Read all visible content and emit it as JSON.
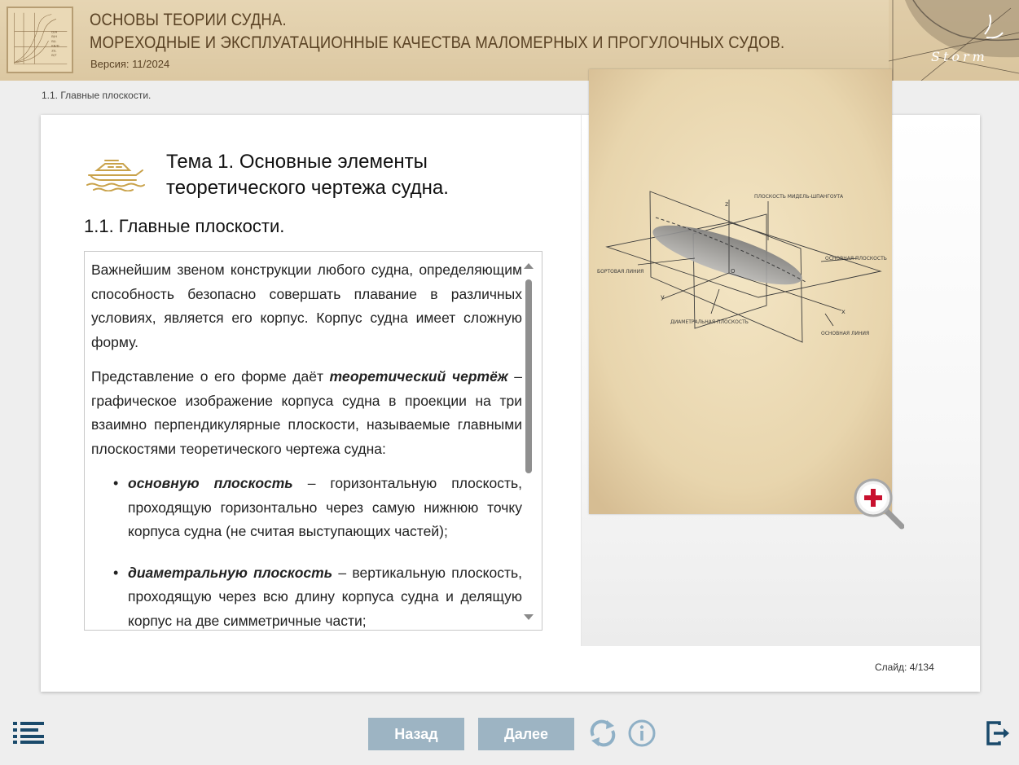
{
  "header": {
    "title_line1": "ОСНОВЫ ТЕОРИИ СУДНА.",
    "title_line2": "МОРЕХОДНЫЕ И ЭКСПЛУАТАЦИОННЫЕ КАЧЕСТВА МАЛОМЕРНЫХ И ПРОГУЛОЧНЫХ СУДОВ.",
    "version": "Версия: 11/2024",
    "logo_text": "Storm"
  },
  "breadcrumb": "1.1. Главные плоскости.",
  "topic": {
    "title_line1": "Тема 1. Основные элементы",
    "title_line2": "теоретического чертежа судна."
  },
  "section_title": "1.1. Главные плоскости.",
  "content": {
    "p1": "Важнейшим звеном конструкции любого судна, определяющим способность безопасно совершать плавание в различных условиях, является его корпус. Корпус судна имеет сложную форму.",
    "p2_a": "Представление о его форме даёт ",
    "p2_b": "теоретический чертёж",
    "p2_c": " – графическое изображение корпуса судна в проекции на три взаимно перпендикулярные плоскости, называемые главными плоскостями теоретического чертежа судна:",
    "li1_term": "основную плоскость",
    "li1_text": " – горизонтальную плоскость, проходящую горизонтально через самую нижнюю точку корпуса судна (не считая выступающих частей);",
    "li2_term": "диаметральную плоскость",
    "li2_text": " – вертикальную плоскость, проходящую через всю длину корпуса судна и делящую корпус на две симметричные части;"
  },
  "figure_labels": {
    "midship": "ПЛОСКОСТЬ МИДЕЛЬ-ШПАНГОУТА",
    "base_plane": "ОСНОВНАЯ ПЛОСКОСТЬ",
    "side_line": "БОРТОВАЯ ЛИНИЯ",
    "diametral": "ДИАМЕТРАЛЬНАЯ ПЛОСКОСТЬ",
    "base_line": "ОСНОВНАЯ ЛИНИЯ",
    "axis_z": "z",
    "axis_y": "y",
    "axis_x": "x",
    "origin": "O"
  },
  "slide_counter": "Слайд:  4/134",
  "nav": {
    "back": "Назад",
    "next": "Далее"
  },
  "colors": {
    "header_bg": "#e0cda8",
    "header_text": "#5a4224",
    "button_bg": "#9db4c3",
    "icon_blue": "#1a4a6b",
    "zoom_red": "#c8102e"
  },
  "icons": {
    "menu": "list-menu-icon",
    "reload": "reload-icon",
    "info": "info-icon",
    "exit": "exit-icon",
    "zoom": "zoom-in-icon",
    "topic": "boat-icon"
  }
}
